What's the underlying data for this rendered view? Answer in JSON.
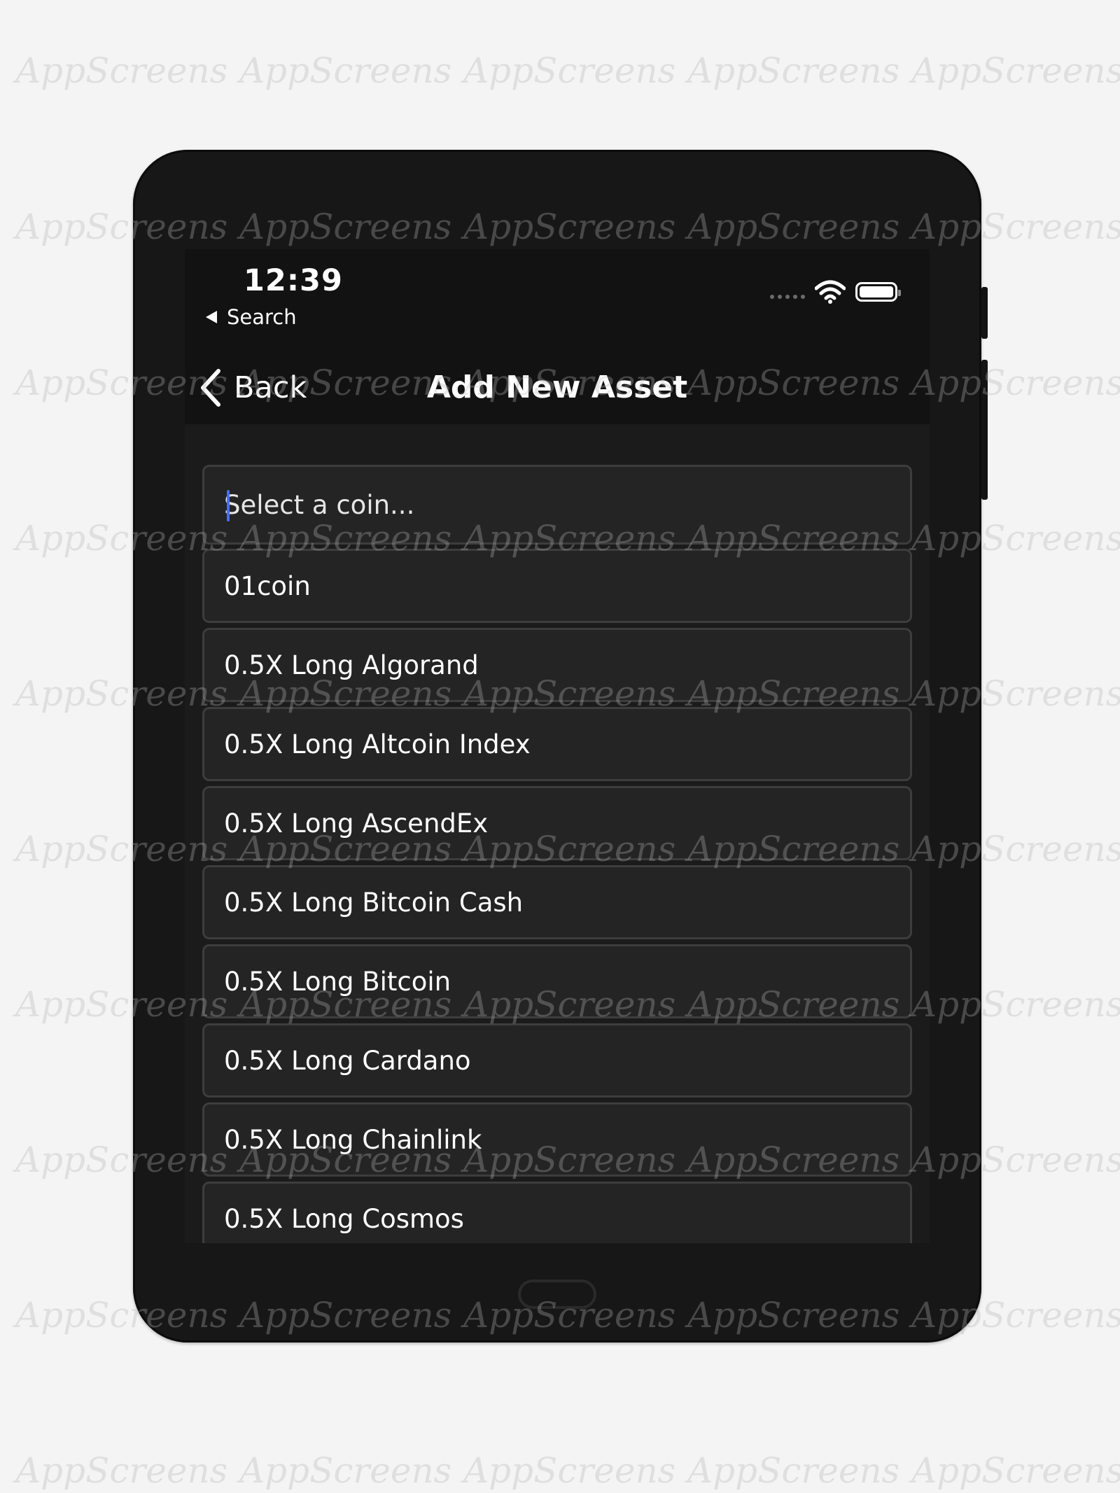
{
  "status_bar": {
    "time": "12:39",
    "back_app": "Search"
  },
  "nav": {
    "back_label": "Back",
    "title": "Add New Asset"
  },
  "search": {
    "placeholder": "Select a coin..."
  },
  "coins": [
    "01coin",
    "0.5X Long Algorand",
    "0.5X Long Altcoin Index",
    "0.5X Long AscendEx",
    "0.5X Long Bitcoin Cash",
    "0.5X Long Bitcoin",
    "0.5X Long Cardano",
    "0.5X Long Chainlink",
    "0.5X Long Cosmos"
  ],
  "watermark": {
    "text": "AppScreens"
  },
  "colors": {
    "accent": "#4a6cff",
    "background": "#1b1b1b",
    "row_bg": "#242424",
    "row_border": "#3d3d3d"
  }
}
